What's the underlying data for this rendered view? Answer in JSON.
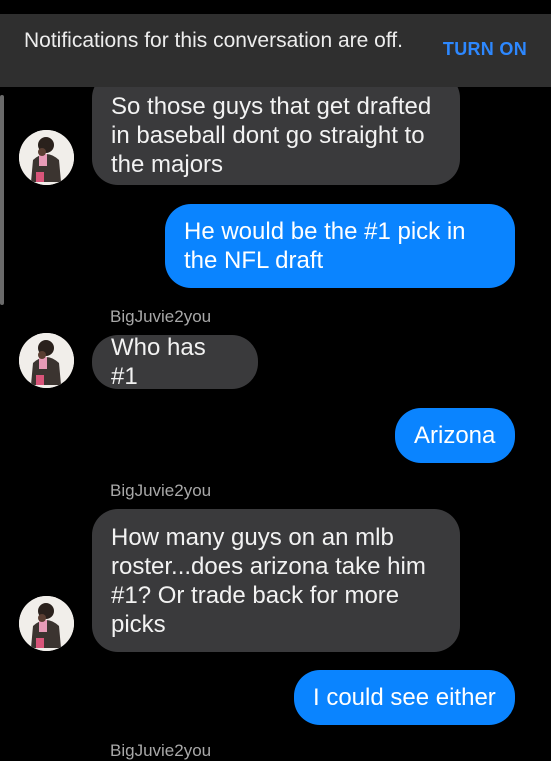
{
  "banner": {
    "text": "Notifications for this conversation are off.",
    "button_label": "TURN ON"
  },
  "messages": [
    {
      "side": "in",
      "text": "So those guys that get drafted in baseball dont go straight to the majors"
    },
    {
      "side": "out",
      "text": "He would be the #1 pick in the NFL draft"
    },
    {
      "side": "in",
      "sender": "BigJuvie2you",
      "text": "Who has #1"
    },
    {
      "side": "out",
      "text": "Arizona"
    },
    {
      "side": "in",
      "sender": "BigJuvie2you",
      "text": "How many guys on an mlb roster...does arizona take him #1? Or trade back for more picks"
    },
    {
      "side": "out",
      "text": "I could see either"
    },
    {
      "side": "in",
      "sender": "BigJuvie2you"
    }
  ],
  "avatar_icon": "user-avatar-photo",
  "colors": {
    "incoming_bubble": "#3a3a3c",
    "outgoing_bubble": "#0a84ff",
    "banner_background": "#2f2f2f",
    "accent": "#2d88ff"
  }
}
